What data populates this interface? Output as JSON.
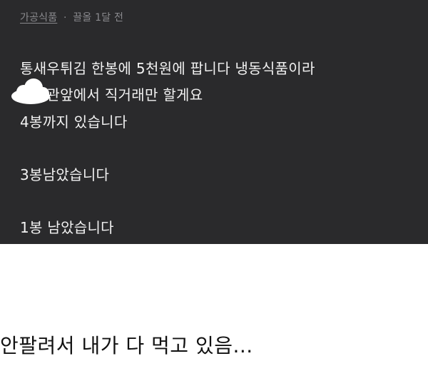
{
  "post": {
    "category": "가공식품",
    "separator": "·",
    "author": "끌올",
    "time": "1달 전",
    "lines": [
      "통새우튀김 한봉에 5천원에 팝니다 냉동식품이라",
      "도서관앞에서 직거래만 할게요",
      "4봉까지 있습니다",
      "3봉남았습니다",
      "1봉 남았습니다"
    ]
  },
  "caption": {
    "text": "안팔려서 내가 다 먹고 있음..."
  },
  "icons": {
    "cloud": "cloud-icon"
  }
}
